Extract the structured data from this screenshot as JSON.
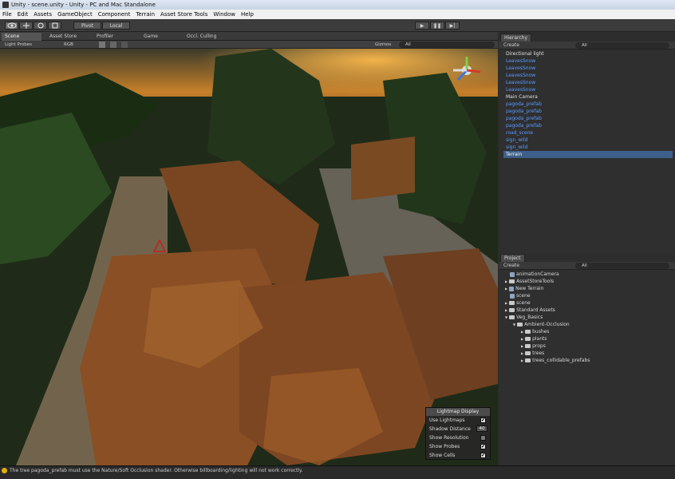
{
  "window": {
    "title": "Unity - scene.unity - Unity - PC and Mac Standalone"
  },
  "menu": [
    "File",
    "Edit",
    "Assets",
    "GameObject",
    "Component",
    "Terrain",
    "Asset Store Tools",
    "Window",
    "Help"
  ],
  "toolbar": {
    "pivot": "Pivot",
    "local": "Local",
    "play": "▶",
    "pause": "❚❚",
    "step": "▶|"
  },
  "tabs": {
    "scene": "Scene",
    "asset_store": "Asset Store",
    "profiler": "Profiler",
    "game": "Game",
    "occlusion": "Occl. Culling"
  },
  "scenebar": {
    "mode": "Light Probes",
    "render": "RGB",
    "gizmos": "Gizmos",
    "search": "All"
  },
  "hierarchy": {
    "tab": "Hierarchy",
    "create": "Create",
    "search": "All",
    "items": [
      {
        "label": "Directional light",
        "color": "#e0e0e0"
      },
      {
        "label": "LeavesSnow",
        "color": "#5b9bff"
      },
      {
        "label": "LeavesSnow",
        "color": "#5b9bff"
      },
      {
        "label": "LeavesSnow",
        "color": "#5b9bff"
      },
      {
        "label": "LeavesSnow",
        "color": "#5b9bff"
      },
      {
        "label": "LeavesSnow",
        "color": "#5b9bff"
      },
      {
        "label": "Main Camera",
        "color": "#e0e0e0"
      },
      {
        "label": "pagoda_prefab",
        "color": "#5b9bff"
      },
      {
        "label": "pagoda_prefab",
        "color": "#5b9bff"
      },
      {
        "label": "pagoda_prefab",
        "color": "#5b9bff"
      },
      {
        "label": "pagoda_prefab",
        "color": "#5b9bff"
      },
      {
        "label": "road_scene",
        "color": "#5b9bff"
      },
      {
        "label": "sign_wild",
        "color": "#5b9bff"
      },
      {
        "label": "sign_wild",
        "color": "#5b9bff"
      },
      {
        "label": "Terrain",
        "color": "#ffffff"
      }
    ]
  },
  "project": {
    "tab": "Project",
    "create": "Create",
    "search": "All",
    "items": [
      {
        "label": "animationCamera",
        "icon": "script-icon"
      },
      {
        "label": "AssetStoreTools",
        "icon": "folder-icon"
      },
      {
        "label": "New Terrain",
        "icon": "terrain-icon"
      },
      {
        "label": "scene",
        "icon": "unity-scene-icon"
      },
      {
        "label": "scene",
        "icon": "folder-icon"
      },
      {
        "label": "Standard Assets",
        "icon": "folder-icon"
      },
      {
        "label": "Veg_Basics",
        "icon": "folder-icon"
      },
      {
        "label": "Ambient-Occlusion",
        "icon": "folder-icon"
      },
      {
        "label": "bushes",
        "icon": "folder-icon"
      },
      {
        "label": "plants",
        "icon": "folder-icon"
      },
      {
        "label": "props",
        "icon": "folder-icon"
      },
      {
        "label": "trees",
        "icon": "folder-icon"
      },
      {
        "label": "trees_collidable_prefabs",
        "icon": "folder-icon"
      }
    ]
  },
  "lightmap": {
    "title": "Lightmap Display",
    "use_lightmaps": "Use Lightmaps",
    "shadow_distance": "Shadow Distance",
    "shadow_distance_value": "40",
    "show_resolution": "Show Resolution",
    "show_probes": "Show Probes",
    "show_cells": "Show Cells"
  },
  "status": {
    "message": "The tree pagoda_prefab must use the Nature/Soft Occlusion shader. Otherwise billboarding/lighting will not work correctly."
  }
}
